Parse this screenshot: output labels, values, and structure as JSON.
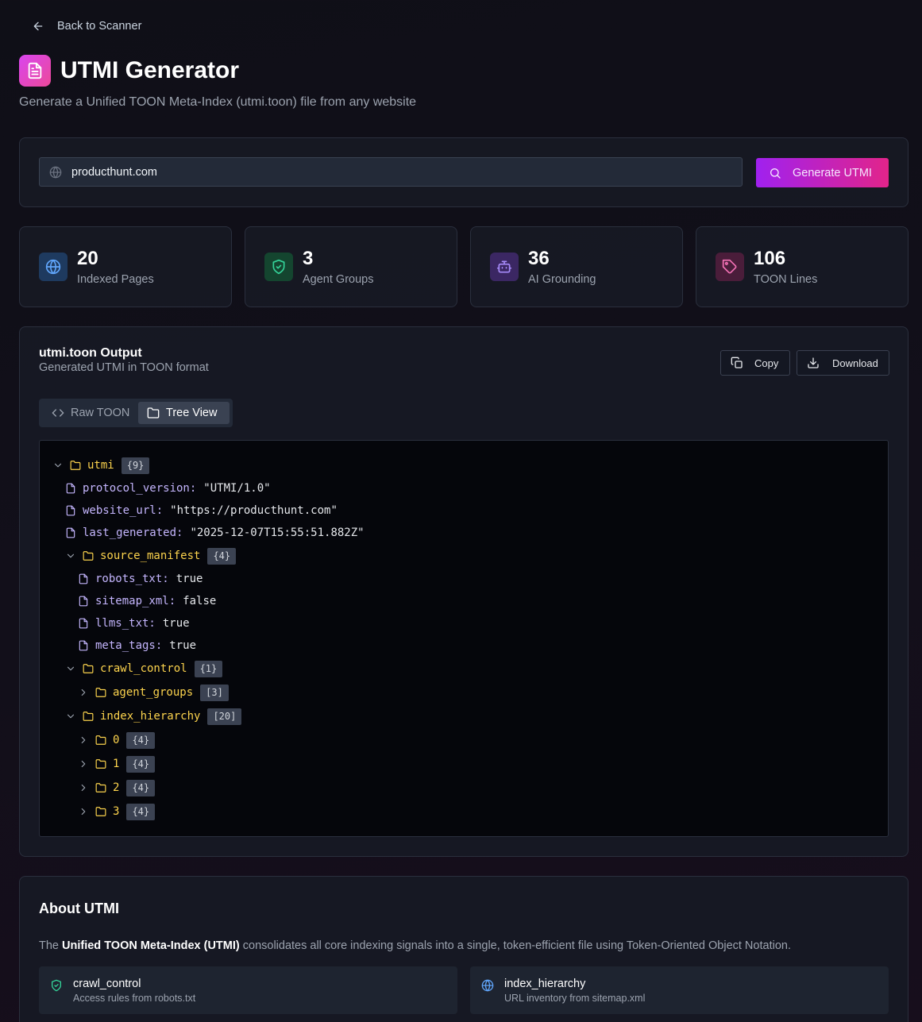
{
  "nav": {
    "back_label": "Back to Scanner"
  },
  "header": {
    "title": "UTMI Generator",
    "subtitle": "Generate a Unified TOON Meta-Index (utmi.toon) file from any website"
  },
  "search": {
    "value": "producthunt.com",
    "button_label": "Generate UTMI"
  },
  "stats": [
    {
      "value": "20",
      "label": "Indexed Pages",
      "icon": "globe-icon",
      "color": "#60a5fa"
    },
    {
      "value": "3",
      "label": "Agent Groups",
      "icon": "shield-icon",
      "color": "#34d399"
    },
    {
      "value": "36",
      "label": "AI Grounding",
      "icon": "bot-icon",
      "color": "#a78bfa"
    },
    {
      "value": "106",
      "label": "TOON Lines",
      "icon": "tag-icon",
      "color": "#f472b6"
    }
  ],
  "output": {
    "title": "utmi.toon Output",
    "subtitle": "Generated UTMI in TOON format",
    "copy_label": "Copy",
    "download_label": "Download",
    "tabs": [
      {
        "label": "Raw TOON",
        "active": false
      },
      {
        "label": "Tree View",
        "active": true
      }
    ]
  },
  "tree": {
    "utmi": {
      "key": "utmi",
      "badge": "{9}"
    },
    "protocol_version": {
      "key": "protocol_version:",
      "value": "\"UTMI/1.0\""
    },
    "website_url": {
      "key": "website_url:",
      "value": "\"https://producthunt.com\""
    },
    "last_generated": {
      "key": "last_generated:",
      "value": "\"2025-12-07T15:55:51.882Z\""
    },
    "source_manifest": {
      "key": "source_manifest",
      "badge": "{4}"
    },
    "robots_txt": {
      "key": "robots_txt:",
      "value": "true"
    },
    "sitemap_xml": {
      "key": "sitemap_xml:",
      "value": "false"
    },
    "llms_txt": {
      "key": "llms_txt:",
      "value": "true"
    },
    "meta_tags": {
      "key": "meta_tags:",
      "value": "true"
    },
    "crawl_control": {
      "key": "crawl_control",
      "badge": "{1}"
    },
    "agent_groups": {
      "key": "agent_groups",
      "badge": "[3]"
    },
    "index_hierarchy": {
      "key": "index_hierarchy",
      "badge": "[20]"
    },
    "item0": {
      "key": "0",
      "badge": "{4}"
    },
    "item1": {
      "key": "1",
      "badge": "{4}"
    },
    "item2": {
      "key": "2",
      "badge": "{4}"
    },
    "item3": {
      "key": "3",
      "badge": "{4}"
    }
  },
  "about": {
    "title": "About UTMI",
    "text_prefix": "The",
    "text_bold": "Unified TOON Meta-Index (UTMI)",
    "text_suffix": "consolidates all core indexing signals into a single, token-efficient file using Token-Oriented Object Notation.",
    "cards": [
      {
        "title": "crawl_control",
        "subtitle": "Access rules from robots.txt",
        "icon": "shield-icon"
      },
      {
        "title": "index_hierarchy",
        "subtitle": "URL inventory from sitemap.xml",
        "icon": "globe-icon"
      }
    ]
  }
}
